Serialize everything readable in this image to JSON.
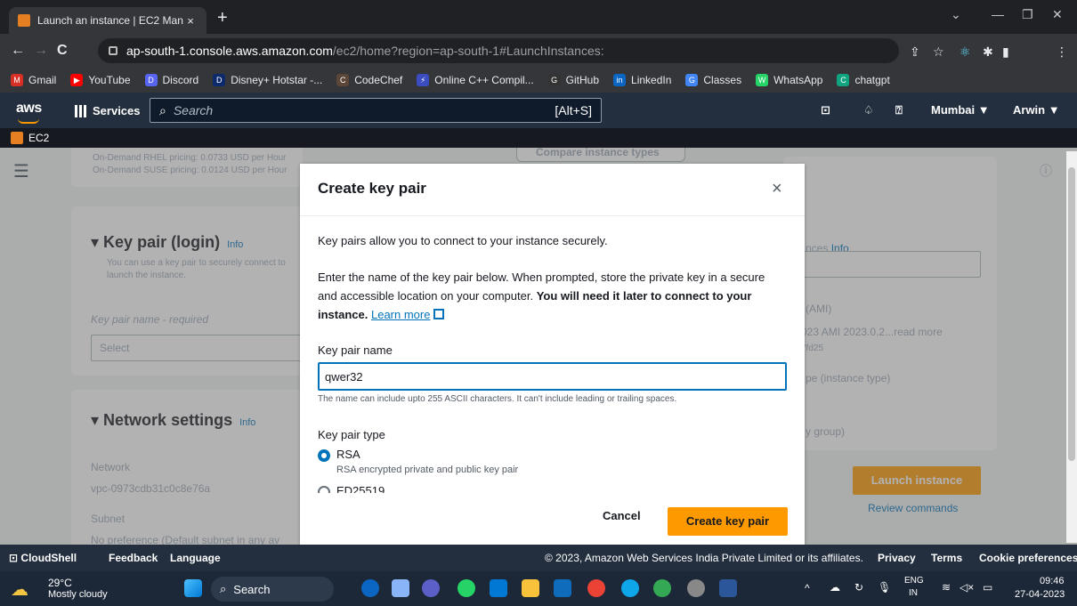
{
  "browser": {
    "tab_title": "Launch an instance | EC2 Manag",
    "tab_close": "×",
    "new_tab": "+",
    "url_host": "ap-south-1.console.aws.amazon.com",
    "url_path": "/ec2/home?region=ap-south-1#LaunchInstances:",
    "profile_initial": "A"
  },
  "bookmarks": [
    {
      "label": "Gmail",
      "color": "#d93025",
      "glyph": "M"
    },
    {
      "label": "YouTube",
      "color": "#ff0000",
      "glyph": "▶"
    },
    {
      "label": "Discord",
      "color": "#5865f2",
      "glyph": "D"
    },
    {
      "label": "Disney+ Hotstar -...",
      "color": "#0c2a6b",
      "glyph": "D"
    },
    {
      "label": "CodeChef",
      "color": "#5b4638",
      "glyph": "C"
    },
    {
      "label": "Online C++ Compil...",
      "color": "#3b4cc0",
      "glyph": "⚡"
    },
    {
      "label": "GitHub",
      "color": "#333333",
      "glyph": "G"
    },
    {
      "label": "LinkedIn",
      "color": "#0a66c2",
      "glyph": "in"
    },
    {
      "label": "Classes",
      "color": "#4285f4",
      "glyph": "G"
    },
    {
      "label": "WhatsApp",
      "color": "#25d366",
      "glyph": "W"
    },
    {
      "label": "chatgpt",
      "color": "#10a37f",
      "glyph": "C"
    }
  ],
  "aws_nav": {
    "logo": "aws",
    "services": "Services",
    "search_placeholder": "Search",
    "search_shortcut": "[Alt+S]",
    "region": "Mumbai ▼",
    "user": "Arwin ▼"
  },
  "service_bar": {
    "label": "EC2"
  },
  "background": {
    "pricing1": "On-Demand RHEL pricing: 0.0733 USD per Hour",
    "pricing2": "On-Demand SUSE pricing: 0.0124 USD per Hour",
    "compare": "Compare instance types",
    "keypair_heading": "Key pair (login)",
    "keypair_info": "Info",
    "keypair_desc1": "You can use a key pair to securely connect to",
    "keypair_desc2": "launch the instance.",
    "keypair_name_label": "Key pair name - required",
    "keypair_select": "Select",
    "network_heading": "Network settings",
    "network_info": "Info",
    "network_label": "Network",
    "network_value": "vpc-0973cdb31c0c8e76a",
    "subnet_label": "Subnet",
    "subnet_value": "No preference (Default subnet in any av",
    "instances_label": "nces",
    "instances_info": "Info",
    "ami_label": "(AMI)",
    "ami_value": "023 AMI 2023.0.2...read more",
    "ami_id": "7fd25",
    "type_label": "pe (instance type)",
    "sg_label": "y group)",
    "launch_button": "Launch instance",
    "review": "Review commands"
  },
  "modal": {
    "title": "Create key pair",
    "close": "×",
    "intro": "Key pairs allow you to connect to your instance securely.",
    "desc_plain": "Enter the name of the key pair below. When prompted, store the private key in a secure and accessible location on your computer. ",
    "desc_bold": "You will need it later to connect to your instance.",
    "learn_more": "Learn more",
    "name_label": "Key pair name",
    "name_value": "qwer32",
    "name_hint": "The name can include upto 255 ASCII characters. It can't include leading or trailing spaces.",
    "type_label": "Key pair type",
    "options": [
      {
        "label": "RSA",
        "desc": "RSA encrypted private and public key pair",
        "selected": true
      },
      {
        "label": "ED25519",
        "selected": false
      }
    ],
    "cancel": "Cancel",
    "create": "Create key pair"
  },
  "footer": {
    "cloudshell": "CloudShell",
    "feedback": "Feedback",
    "language": "Language",
    "copyright": "© 2023, Amazon Web Services India Private Limited or its affiliates.",
    "privacy": "Privacy",
    "terms": "Terms",
    "cookie": "Cookie preferences"
  },
  "taskbar": {
    "temp": "29°C",
    "weather": "Mostly cloudy",
    "search": "Search",
    "lang1": "ENG",
    "lang2": "IN",
    "time": "09:46",
    "date": "27-04-2023"
  },
  "colors": {
    "aws_orange": "#ff9900",
    "aws_nav": "#232f3e",
    "link_blue": "#0073bb"
  }
}
